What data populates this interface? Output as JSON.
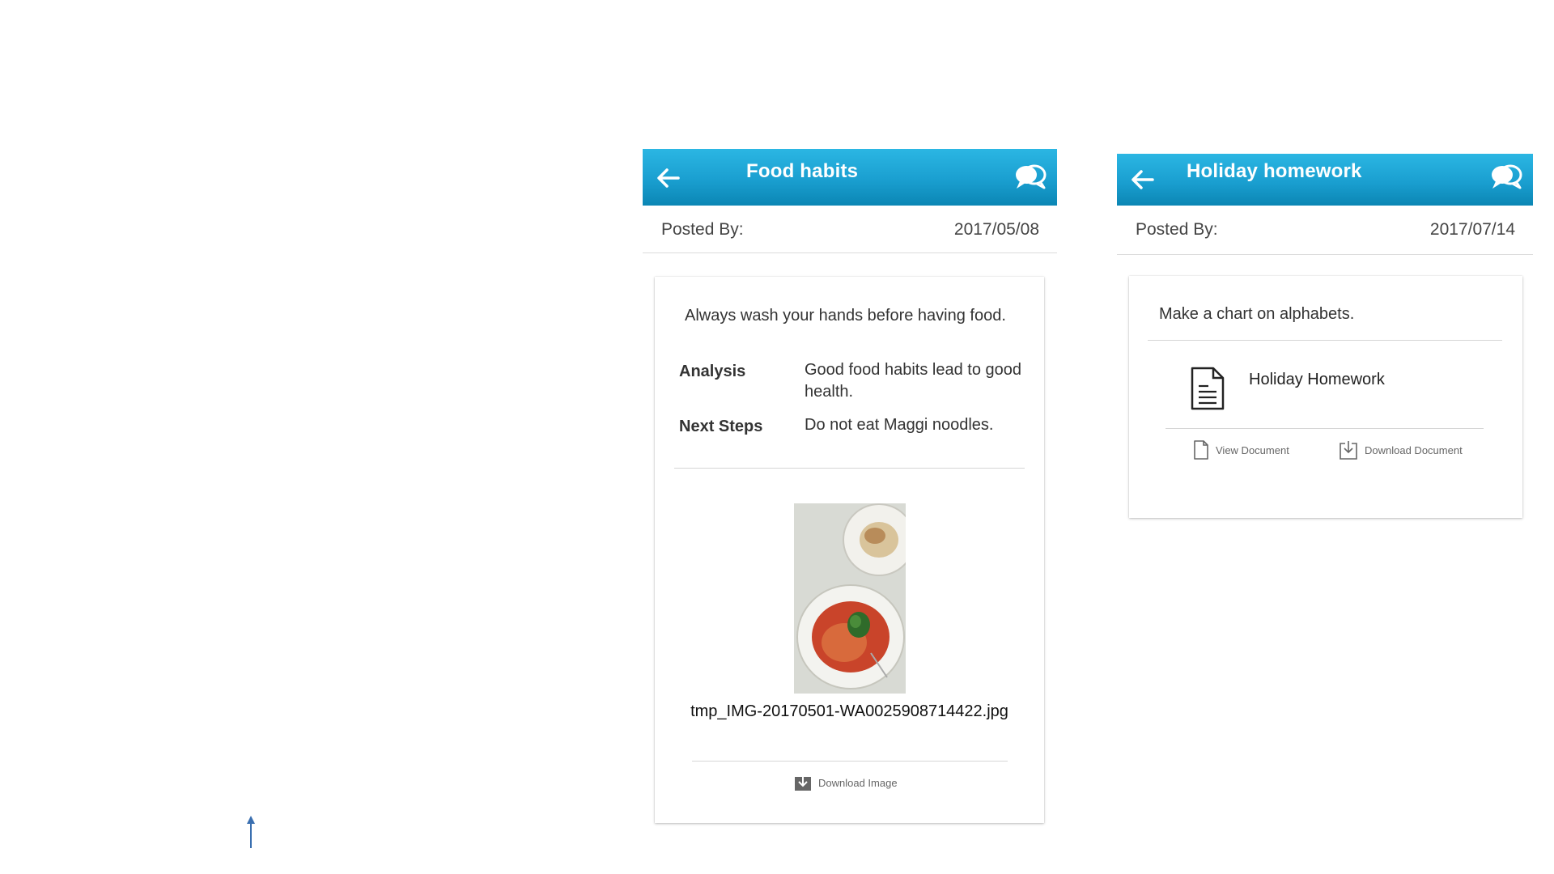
{
  "panels": [
    {
      "title": "Food habits",
      "posted_by_label": "Posted By:",
      "date": "2017/05/08",
      "description": "Always wash your hands before having food.",
      "analysis_label": "Analysis",
      "analysis_value": "Good food habits lead to good health.",
      "next_steps_label": "Next Steps",
      "next_steps_value": "Do not eat Maggi noodles.",
      "attachment": {
        "file_name": "tmp_IMG-20170501-WA0025908714422.jpg",
        "download_label": "Download Image"
      }
    },
    {
      "title": "Holiday homework",
      "posted_by_label": "Posted By:",
      "date": "2017/07/14",
      "description": "Make a chart on alphabets.",
      "document": {
        "name": "Holiday Homework",
        "view_label": "View Document",
        "download_label": "Download Document"
      }
    }
  ],
  "colors": {
    "appbar_top": "#2bb6e3",
    "appbar_bottom": "#0b86b4",
    "arrow_blue": "#3a6fb0"
  },
  "icons": [
    "back-arrow-icon",
    "chat-bubbles-icon",
    "download-icon",
    "document-icon",
    "view-document-icon",
    "download-document-icon",
    "up-arrow-icon"
  ]
}
